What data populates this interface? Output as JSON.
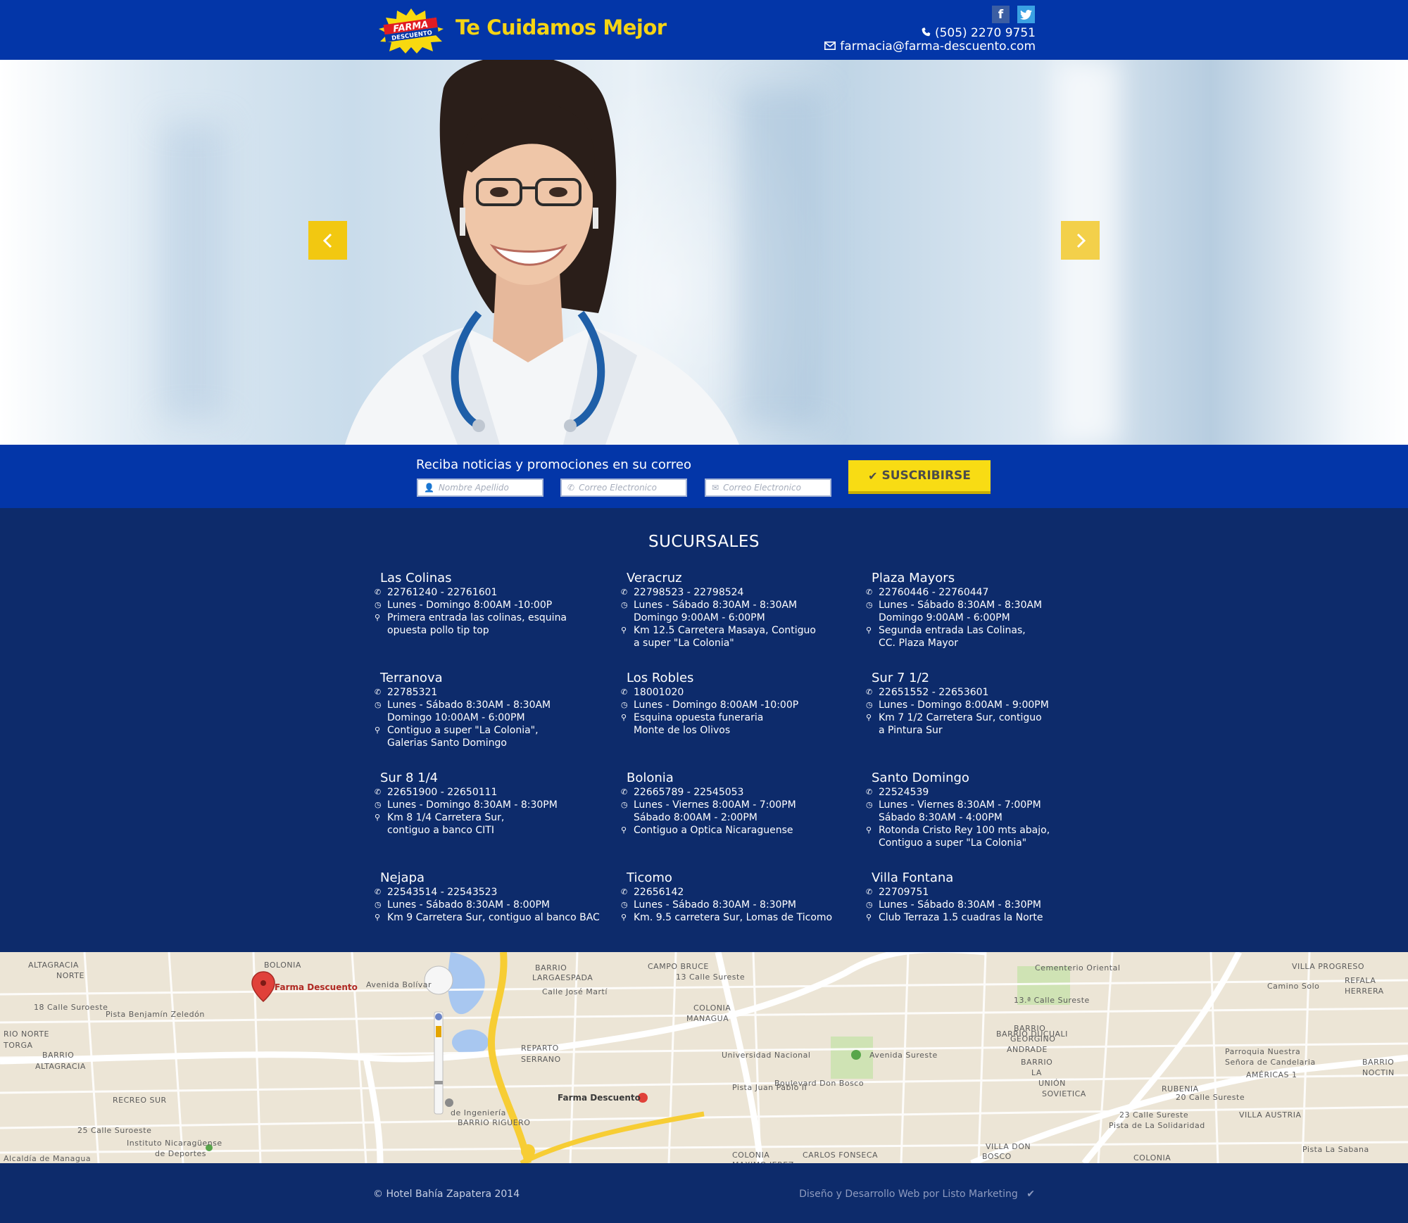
{
  "header": {
    "logo_top": "FARMA",
    "logo_bottom": "DESCUENTO",
    "tagline": "Te Cuidamos Mejor",
    "facebook_icon": "f",
    "twitter_icon": "t",
    "phone": "(505) 2270 9751",
    "email": "farmacia@farma-descuento.com",
    "phone_icon": "phone-icon",
    "email_icon": "envelope-icon"
  },
  "hero": {
    "prev_icon": "chevron-left-icon",
    "next_icon": "chevron-right-icon",
    "accent": "#f2c811"
  },
  "subscribe": {
    "title": "Reciba noticias y promociones en su correo",
    "name_placeholder": "Nombre Apellido",
    "phone_placeholder": "Correo Electronico",
    "email_placeholder": "Correo Electronico",
    "button_label": "SUSCRIBIRSE"
  },
  "branches": {
    "title": "SUCURSALES",
    "items": [
      {
        "name": "Las Colinas",
        "phone": "22761240 - 22761601",
        "hours": "Lunes - Domingo 8:00AM -10:00P",
        "address": "Primera entrada las colinas, esquina\nopuesta pollo tip top"
      },
      {
        "name": "Veracruz",
        "phone": "22798523 - 22798524",
        "hours": "Lunes - Sábado 8:30AM - 8:30AM\nDomingo 9:00AM - 6:00PM",
        "address": "Km 12.5 Carretera Masaya, Contiguo\na super \"La Colonia\""
      },
      {
        "name": "Plaza Mayors",
        "phone": "22760446 - 22760447",
        "hours": "Lunes - Sábado 8:30AM - 8:30AM\nDomingo 9:00AM - 6:00PM",
        "address": "Segunda entrada Las Colinas,\nCC. Plaza Mayor"
      },
      {
        "name": "Terranova",
        "phone": "22785321",
        "hours": "Lunes - Sábado 8:30AM - 8:30AM\nDomingo 10:00AM - 6:00PM",
        "address": "Contiguo a super \"La Colonia\",\nGalerias Santo Domingo"
      },
      {
        "name": "Los Robles",
        "phone": "18001020",
        "hours": "Lunes - Domingo 8:00AM -10:00P",
        "address": "Esquina opuesta funeraria\nMonte de los Olivos"
      },
      {
        "name": "Sur 7 1/2",
        "phone": "22651552 - 22653601",
        "hours": "Lunes - Domingo 8:00AM - 9:00PM",
        "address": "Km 7 1/2 Carretera Sur, contiguo\na Pintura Sur"
      },
      {
        "name": "Sur 8 1/4",
        "phone": "22651900 - 22650111",
        "hours": "Lunes - Domingo 8:30AM - 8:30PM",
        "address": "Km 8 1/4 Carretera Sur,\ncontiguo a banco CITI"
      },
      {
        "name": "Bolonia",
        "phone": "22665789 - 22545053",
        "hours": "Lunes - Viernes 8:00AM - 7:00PM\nSábado 8:00AM - 2:00PM",
        "address": "Contiguo a Optica Nicaraguense"
      },
      {
        "name": "Santo Domingo",
        "phone": "22524539",
        "hours": "Lunes - Viernes 8:30AM - 7:00PM\nSábado 8:30AM - 4:00PM",
        "address": "Rotonda Cristo Rey 100 mts abajo,\nContiguo a super \"La Colonia\""
      },
      {
        "name": "Nejapa",
        "phone": "22543514 - 22543523",
        "hours": "Lunes - Sábado 8:30AM - 8:00PM",
        "address": "Km 9 Carretera Sur, contiguo al banco BAC"
      },
      {
        "name": "Ticomo",
        "phone": "22656142",
        "hours": "Lunes - Sábado 8:30AM - 8:30PM",
        "address": "Km. 9.5 carretera Sur, Lomas de Ticomo"
      },
      {
        "name": "Villa Fontana",
        "phone": "22709751",
        "hours": "Lunes - Sábado 8:30AM - 8:30PM",
        "address": "Club Terraza 1.5 cuadras la Norte"
      }
    ]
  },
  "map": {
    "marker_label": "Farma Descuento",
    "marker_label_2": "Farma Descuento",
    "labels": [
      "ALTAGRACIA",
      "NORTE",
      "BOLONIA",
      "18 Calle Suroeste",
      "Pista Benjamín Zeledón",
      "RIO NORTE",
      "TORGA",
      "BARRIO",
      "ALTAGRACIA",
      "RECREO SUR",
      "25 Calle Suroeste",
      "Instituto Nicaragüense",
      "de Deportes",
      "Alcaldía de Managua",
      "Avenida Bolívar",
      "BARRIO",
      "LARGAESPADA",
      "Calle José Martí",
      "CAMPO BRUCE",
      "13 Calle Sureste",
      "COLONIA",
      "MANAGUA",
      "REPARTO",
      "SERRANO",
      "Universidad Nacional",
      "de Ingeniería",
      "BARRIO RIGUERO",
      "Pista Juan Pablo II",
      "BARRIO DUCUALI",
      "COLONIA",
      "MAXIMO JEREZ",
      "CARLOS FONSECA",
      "Cementerio Oriental",
      "13.ª Calle Sureste",
      "BARRIO",
      "GEORGINO",
      "ANDRADE",
      "BARRIO",
      "LA",
      "UNIÓN",
      "SOVIETICA",
      "RUBENIA",
      "AMÉRICAS 1",
      "VILLA AUSTRIA",
      "VILLA PROGRESO",
      "Camino Solo",
      "REFALA",
      "HERRERA",
      "Parroquia Nuestra",
      "Señora de Candelaria",
      "BARRIO",
      "NOCTIN",
      "COLONIA",
      "VILLA DON",
      "BOSCO",
      "23 Calle Sureste",
      "Pista La Sabana",
      "Boulevard Don Bosco",
      "Pista de La Solidaridad",
      "20 Calle Sureste",
      "Avenida Sureste"
    ]
  },
  "footer": {
    "copyright": "©  Hotel Bahía Zapatera 2014",
    "credit": "Diseño y Desarrollo Web por Listo Marketing"
  }
}
